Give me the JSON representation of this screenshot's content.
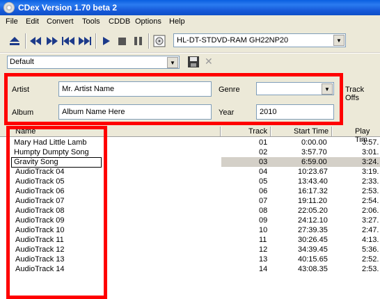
{
  "window": {
    "title": "CDex Version 1.70 beta 2"
  },
  "menu": {
    "items": [
      "File",
      "Edit",
      "Convert",
      "Tools",
      "CDDB",
      "Options",
      "Help"
    ]
  },
  "toolbar": {
    "buttons": [
      "eject-icon",
      "prev-track-icon",
      "next-track-icon",
      "skip-back-icon",
      "skip-forward-icon",
      "play-icon",
      "stop-icon",
      "pause-icon",
      "cd-info-icon"
    ],
    "drive": "HL-DT-STDVD-RAM GH22NP20"
  },
  "profile": {
    "value": "Default"
  },
  "info": {
    "artist_label": "Artist",
    "artist_value": "Mr. Artist Name",
    "album_label": "Album",
    "album_value": "Album Name Here",
    "genre_label": "Genre",
    "genre_value": "",
    "year_label": "Year",
    "year_value": "2010",
    "track_offset_label": "Track Offs"
  },
  "list": {
    "columns": [
      "Name",
      "Track",
      "Start Time",
      "Play Tim"
    ],
    "rows": [
      {
        "name": "Mary Had  Little Lamb",
        "track": "01",
        "start": "0:00.00",
        "play": "3:57."
      },
      {
        "name": "Humpty Dumpty Song",
        "track": "02",
        "start": "3:57.70",
        "play": "3:01."
      },
      {
        "name": "Gravity Song",
        "track": "03",
        "start": "6:59.00",
        "play": "3:24."
      },
      {
        "name": "AudioTrack 04",
        "track": "04",
        "start": "10:23.67",
        "play": "3:19."
      },
      {
        "name": "AudioTrack 05",
        "track": "05",
        "start": "13:43.40",
        "play": "2:33."
      },
      {
        "name": "AudioTrack 06",
        "track": "06",
        "start": "16:17.32",
        "play": "2:53."
      },
      {
        "name": "AudioTrack 07",
        "track": "07",
        "start": "19:11.20",
        "play": "2:54."
      },
      {
        "name": "AudioTrack 08",
        "track": "08",
        "start": "22:05.20",
        "play": "2:06."
      },
      {
        "name": "AudioTrack 09",
        "track": "09",
        "start": "24:12.10",
        "play": "3:27."
      },
      {
        "name": "AudioTrack 10",
        "track": "10",
        "start": "27:39.35",
        "play": "2:47."
      },
      {
        "name": "AudioTrack 11",
        "track": "11",
        "start": "30:26.45",
        "play": "4:13."
      },
      {
        "name": "AudioTrack 12",
        "track": "12",
        "start": "34:39.45",
        "play": "5:36."
      },
      {
        "name": "AudioTrack 13",
        "track": "13",
        "start": "40:15.65",
        "play": "2:52."
      },
      {
        "name": "AudioTrack 14",
        "track": "14",
        "start": "43:08.35",
        "play": "2:53."
      }
    ]
  },
  "colors": {
    "annotation": "#ff0000",
    "titlebar": "#0a5fe0",
    "chrome": "#ece9d8"
  }
}
